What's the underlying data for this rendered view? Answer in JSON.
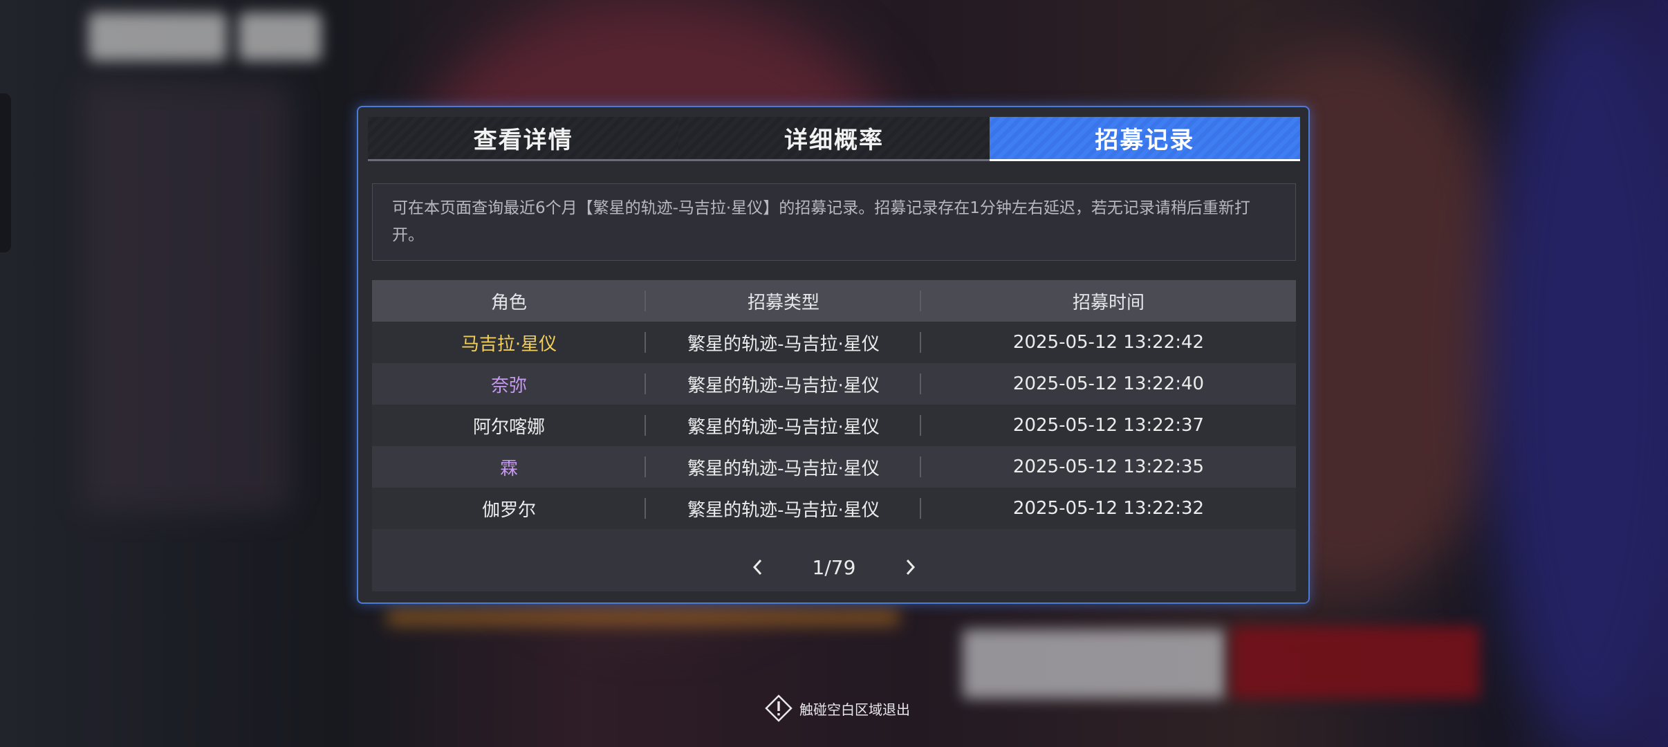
{
  "tabs": [
    {
      "label": "查看详情",
      "active": false
    },
    {
      "label": "详细概率",
      "active": false
    },
    {
      "label": "招募记录",
      "active": true
    }
  ],
  "notice": "可在本页面查询最近6个月【繁星的轨迹-马吉拉·星仪】的招募记录。招募记录存在1分钟左右延迟，若无记录请稍后重新打开。",
  "table": {
    "headers": [
      "角色",
      "招募类型",
      "招募时间"
    ],
    "rows": [
      {
        "role": "马吉拉·星仪",
        "rarity": "gold",
        "type": "繁星的轨迹-马吉拉·星仪",
        "time": "2025-05-12 13:22:42"
      },
      {
        "role": "奈弥",
        "rarity": "purple",
        "type": "繁星的轨迹-马吉拉·星仪",
        "time": "2025-05-12 13:22:40"
      },
      {
        "role": "阿尔喀娜",
        "rarity": "normal",
        "type": "繁星的轨迹-马吉拉·星仪",
        "time": "2025-05-12 13:22:37"
      },
      {
        "role": "霖",
        "rarity": "purple",
        "type": "繁星的轨迹-马吉拉·星仪",
        "time": "2025-05-12 13:22:35"
      },
      {
        "role": "伽罗尔",
        "rarity": "normal",
        "type": "繁星的轨迹-马吉拉·星仪",
        "time": "2025-05-12 13:22:32"
      }
    ]
  },
  "pager": {
    "text": "1/79",
    "prev_icon": "chevron-left-icon",
    "next_icon": "chevron-right-icon"
  },
  "exit_hint": {
    "text": "触碰空白区域退出",
    "icon": "warning-diamond-icon"
  },
  "colors": {
    "accent": "#3f7df2",
    "gold": "#f2cf5a",
    "purple": "#c79af0",
    "border": "#4a7bd6"
  }
}
